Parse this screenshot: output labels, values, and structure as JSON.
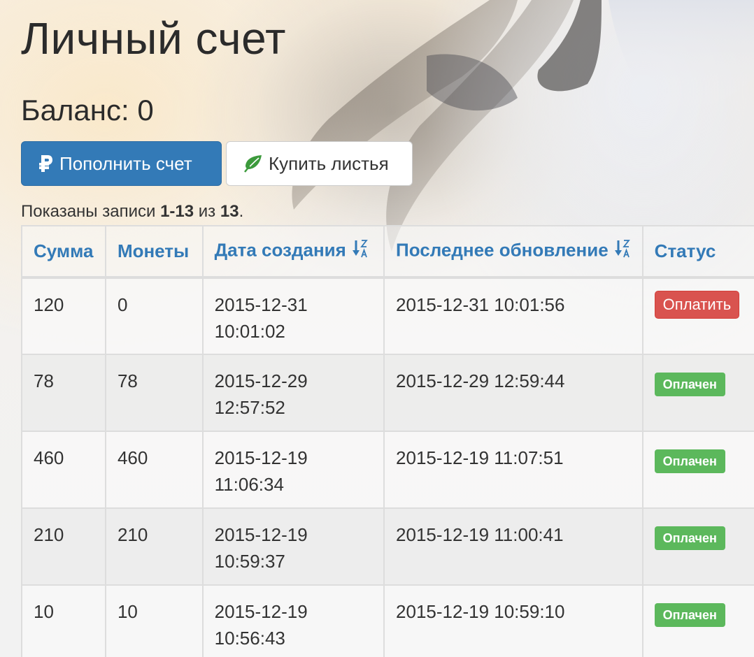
{
  "page": {
    "title": "Личный счет",
    "balance_label": "Баланс: 0"
  },
  "actions": {
    "topup_label": "Пополнить счет",
    "buy_leaves_label": "Купить листья",
    "topup_icon": "ruble-icon",
    "buy_leaves_icon": "leaf-icon"
  },
  "summary": {
    "prefix": "Показаны записи ",
    "range": "1-13",
    "middle": " из ",
    "total": "13",
    "suffix": "."
  },
  "table": {
    "columns": [
      "Сумма",
      "Монеты",
      "Дата создания",
      "Последнее обновление",
      "Статус"
    ],
    "rows": [
      {
        "sum": "120",
        "coins": "0",
        "created_date": "2015-12-31",
        "created_time": "10:01:02",
        "updated": "2015-12-31 10:01:56",
        "status": "Оплатить",
        "status_kind": "pay"
      },
      {
        "sum": "78",
        "coins": "78",
        "created_date": "2015-12-29",
        "created_time": "12:57:52",
        "updated": "2015-12-29 12:59:44",
        "status": "Оплачен",
        "status_kind": "paid"
      },
      {
        "sum": "460",
        "coins": "460",
        "created_date": "2015-12-19",
        "created_time": "11:06:34",
        "updated": "2015-12-19 11:07:51",
        "status": "Оплачен",
        "status_kind": "paid"
      },
      {
        "sum": "210",
        "coins": "210",
        "created_date": "2015-12-19",
        "created_time": "10:59:37",
        "updated": "2015-12-19 11:00:41",
        "status": "Оплачен",
        "status_kind": "paid"
      },
      {
        "sum": "10",
        "coins": "10",
        "created_date": "2015-12-19",
        "created_time": "10:56:43",
        "updated": "2015-12-19 10:59:10",
        "status": "Оплачен",
        "status_kind": "paid"
      }
    ]
  },
  "colors": {
    "primary": "#337ab7",
    "danger": "#d9534f",
    "success": "#5cb85c",
    "leaf": "#3c9a3c"
  }
}
